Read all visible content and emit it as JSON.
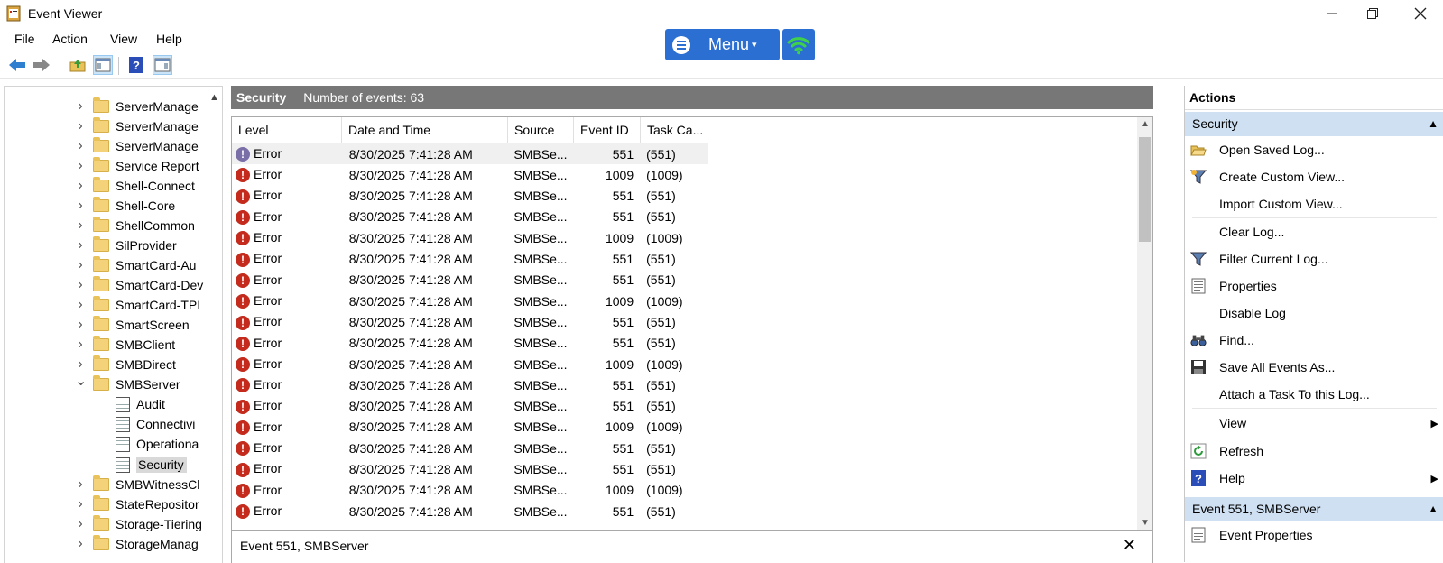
{
  "window": {
    "title": "Event Viewer"
  },
  "menu": [
    "File",
    "Action",
    "View",
    "Help"
  ],
  "overlay": {
    "menu_label": "Menu",
    "caret": "▾"
  },
  "tree": {
    "items": [
      {
        "label": "ServerManage",
        "kind": "folder",
        "depth": 0,
        "expanded": false
      },
      {
        "label": "ServerManage",
        "kind": "folder",
        "depth": 0,
        "expanded": false
      },
      {
        "label": "ServerManage",
        "kind": "folder",
        "depth": 0,
        "expanded": false
      },
      {
        "label": "Service Report",
        "kind": "folder",
        "depth": 0,
        "expanded": false
      },
      {
        "label": "Shell-Connect",
        "kind": "folder",
        "depth": 0,
        "expanded": false
      },
      {
        "label": "Shell-Core",
        "kind": "folder",
        "depth": 0,
        "expanded": false
      },
      {
        "label": "ShellCommon",
        "kind": "folder",
        "depth": 0,
        "expanded": false
      },
      {
        "label": "SilProvider",
        "kind": "folder",
        "depth": 0,
        "expanded": false
      },
      {
        "label": "SmartCard-Au",
        "kind": "folder",
        "depth": 0,
        "expanded": false
      },
      {
        "label": "SmartCard-Dev",
        "kind": "folder",
        "depth": 0,
        "expanded": false
      },
      {
        "label": "SmartCard-TPI",
        "kind": "folder",
        "depth": 0,
        "expanded": false
      },
      {
        "label": "SmartScreen",
        "kind": "folder",
        "depth": 0,
        "expanded": false
      },
      {
        "label": "SMBClient",
        "kind": "folder",
        "depth": 0,
        "expanded": false
      },
      {
        "label": "SMBDirect",
        "kind": "folder",
        "depth": 0,
        "expanded": false
      },
      {
        "label": "SMBServer",
        "kind": "folder",
        "depth": 0,
        "expanded": true
      },
      {
        "label": "Audit",
        "kind": "log",
        "depth": 1
      },
      {
        "label": "Connectivi",
        "kind": "log",
        "depth": 1
      },
      {
        "label": "Operationa",
        "kind": "log",
        "depth": 1
      },
      {
        "label": "Security",
        "kind": "log",
        "depth": 1,
        "selected": true
      },
      {
        "label": "SMBWitnessCl",
        "kind": "folder",
        "depth": 0,
        "expanded": false
      },
      {
        "label": "StateRepositor",
        "kind": "folder",
        "depth": 0,
        "expanded": false
      },
      {
        "label": "Storage-Tiering",
        "kind": "folder",
        "depth": 0,
        "expanded": false
      },
      {
        "label": "StorageManag",
        "kind": "folder",
        "depth": 0,
        "expanded": false
      }
    ]
  },
  "log": {
    "name": "Security",
    "count_text": "Number of events: 63",
    "columns": [
      "Level",
      "Date and Time",
      "Source",
      "Event ID",
      "Task Ca..."
    ],
    "rows": [
      {
        "level": "Error",
        "date": "8/30/2025 7:41:28 AM",
        "source": "SMBSe...",
        "id": "551",
        "task": "(551)"
      },
      {
        "level": "Error",
        "date": "8/30/2025 7:41:28 AM",
        "source": "SMBSe...",
        "id": "1009",
        "task": "(1009)"
      },
      {
        "level": "Error",
        "date": "8/30/2025 7:41:28 AM",
        "source": "SMBSe...",
        "id": "551",
        "task": "(551)"
      },
      {
        "level": "Error",
        "date": "8/30/2025 7:41:28 AM",
        "source": "SMBSe...",
        "id": "551",
        "task": "(551)"
      },
      {
        "level": "Error",
        "date": "8/30/2025 7:41:28 AM",
        "source": "SMBSe...",
        "id": "1009",
        "task": "(1009)"
      },
      {
        "level": "Error",
        "date": "8/30/2025 7:41:28 AM",
        "source": "SMBSe...",
        "id": "551",
        "task": "(551)"
      },
      {
        "level": "Error",
        "date": "8/30/2025 7:41:28 AM",
        "source": "SMBSe...",
        "id": "551",
        "task": "(551)"
      },
      {
        "level": "Error",
        "date": "8/30/2025 7:41:28 AM",
        "source": "SMBSe...",
        "id": "1009",
        "task": "(1009)"
      },
      {
        "level": "Error",
        "date": "8/30/2025 7:41:28 AM",
        "source": "SMBSe...",
        "id": "551",
        "task": "(551)"
      },
      {
        "level": "Error",
        "date": "8/30/2025 7:41:28 AM",
        "source": "SMBSe...",
        "id": "551",
        "task": "(551)"
      },
      {
        "level": "Error",
        "date": "8/30/2025 7:41:28 AM",
        "source": "SMBSe...",
        "id": "1009",
        "task": "(1009)"
      },
      {
        "level": "Error",
        "date": "8/30/2025 7:41:28 AM",
        "source": "SMBSe...",
        "id": "551",
        "task": "(551)"
      },
      {
        "level": "Error",
        "date": "8/30/2025 7:41:28 AM",
        "source": "SMBSe...",
        "id": "551",
        "task": "(551)"
      },
      {
        "level": "Error",
        "date": "8/30/2025 7:41:28 AM",
        "source": "SMBSe...",
        "id": "1009",
        "task": "(1009)"
      },
      {
        "level": "Error",
        "date": "8/30/2025 7:41:28 AM",
        "source": "SMBSe...",
        "id": "551",
        "task": "(551)"
      },
      {
        "level": "Error",
        "date": "8/30/2025 7:41:28 AM",
        "source": "SMBSe...",
        "id": "551",
        "task": "(551)"
      },
      {
        "level": "Error",
        "date": "8/30/2025 7:41:28 AM",
        "source": "SMBSe...",
        "id": "1009",
        "task": "(1009)"
      },
      {
        "level": "Error",
        "date": "8/30/2025 7:41:28 AM",
        "source": "SMBSe...",
        "id": "551",
        "task": "(551)"
      }
    ]
  },
  "detail": {
    "title": "Event 551, SMBServer"
  },
  "actions": {
    "header": "Actions",
    "section1": "Security",
    "items": [
      {
        "label": "Open Saved Log...",
        "icon": "open-folder-icon"
      },
      {
        "label": "Create Custom View...",
        "icon": "funnel-icon"
      },
      {
        "label": "Import Custom View...",
        "icon": ""
      },
      {
        "label": "Clear Log...",
        "icon": ""
      },
      {
        "label": "Filter Current Log...",
        "icon": "filter-icon"
      },
      {
        "label": "Properties",
        "icon": "properties-icon"
      },
      {
        "label": "Disable Log",
        "icon": ""
      },
      {
        "label": "Find...",
        "icon": "binoculars-icon"
      },
      {
        "label": "Save All Events As...",
        "icon": "save-icon"
      },
      {
        "label": "Attach a Task To this Log...",
        "icon": ""
      },
      {
        "label": "View",
        "icon": "",
        "submenu": true
      },
      {
        "label": "Refresh",
        "icon": "refresh-icon"
      },
      {
        "label": "Help",
        "icon": "help-icon",
        "submenu": true
      }
    ],
    "section2": "Event 551, SMBServer",
    "items2": [
      {
        "label": "Event Properties",
        "icon": "properties-icon"
      }
    ]
  },
  "colors": {
    "accent": "#2b6fd3",
    "section_bg": "#cfe0f2",
    "header_bar": "#777777",
    "error": "#c42b1c"
  }
}
